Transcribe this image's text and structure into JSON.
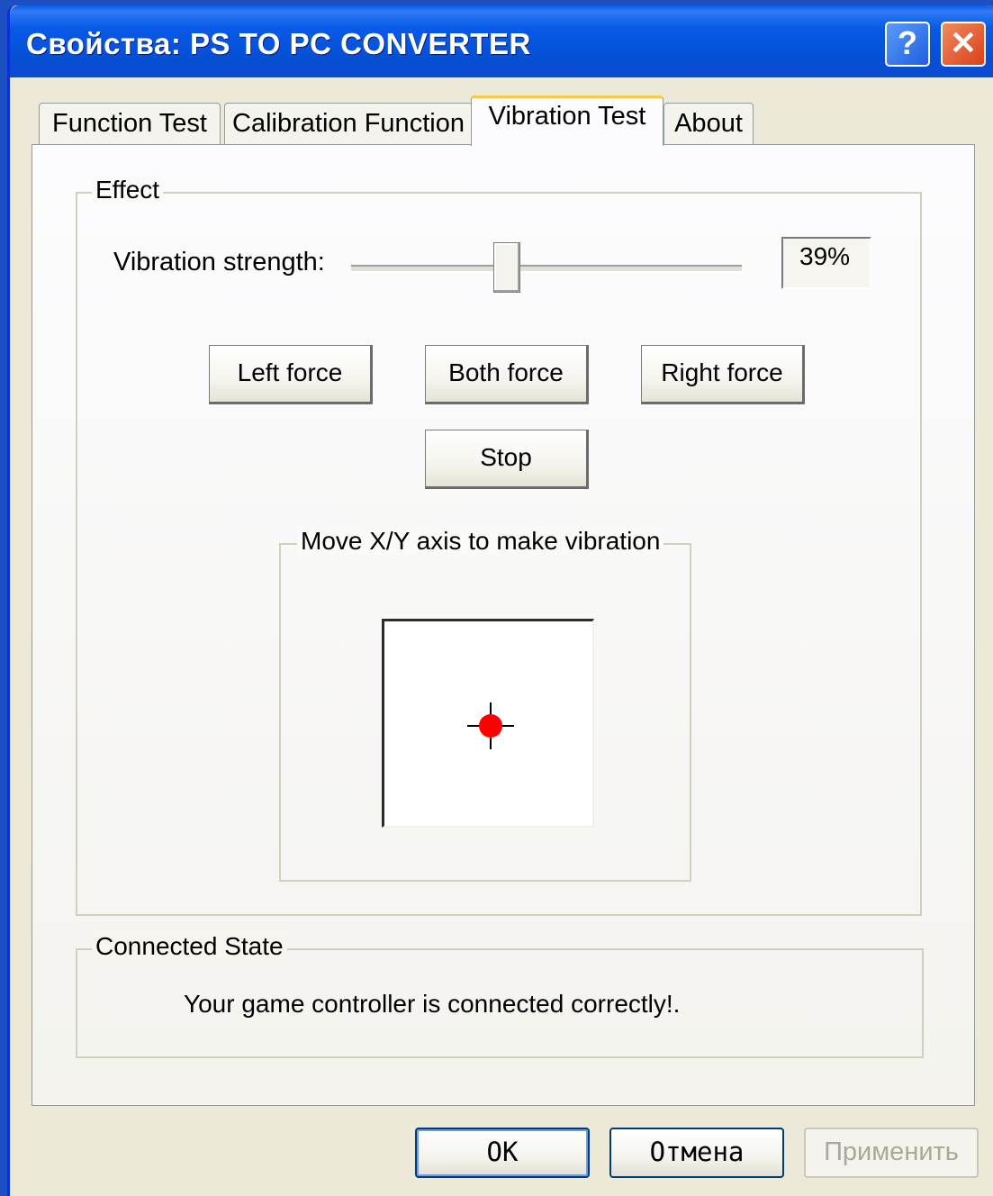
{
  "window": {
    "title": "Свойства: PS TO PC CONVERTER",
    "help_label": "?",
    "close_label": "✕"
  },
  "tabs": [
    {
      "label": "Function Test",
      "active": false
    },
    {
      "label": "Calibration Function",
      "active": false
    },
    {
      "label": "Vibration Test",
      "active": true
    },
    {
      "label": "About",
      "active": false
    }
  ],
  "effect": {
    "group_label": "Effect",
    "vibration_label": "Vibration strength:",
    "vibration_value_text": "39%",
    "vibration_level_percent": 39,
    "buttons": {
      "left": "Left force",
      "both": "Both force",
      "right": "Right force",
      "stop": "Stop"
    },
    "move_group_label": "Move X/Y axis to make vibration",
    "crosshair_color": "#ff0000"
  },
  "connected": {
    "group_label": "Connected State",
    "message": "Your game controller is connected correctly!."
  },
  "dialog_buttons": {
    "ok": "OK",
    "cancel": "Отмена",
    "apply": "Применить"
  }
}
